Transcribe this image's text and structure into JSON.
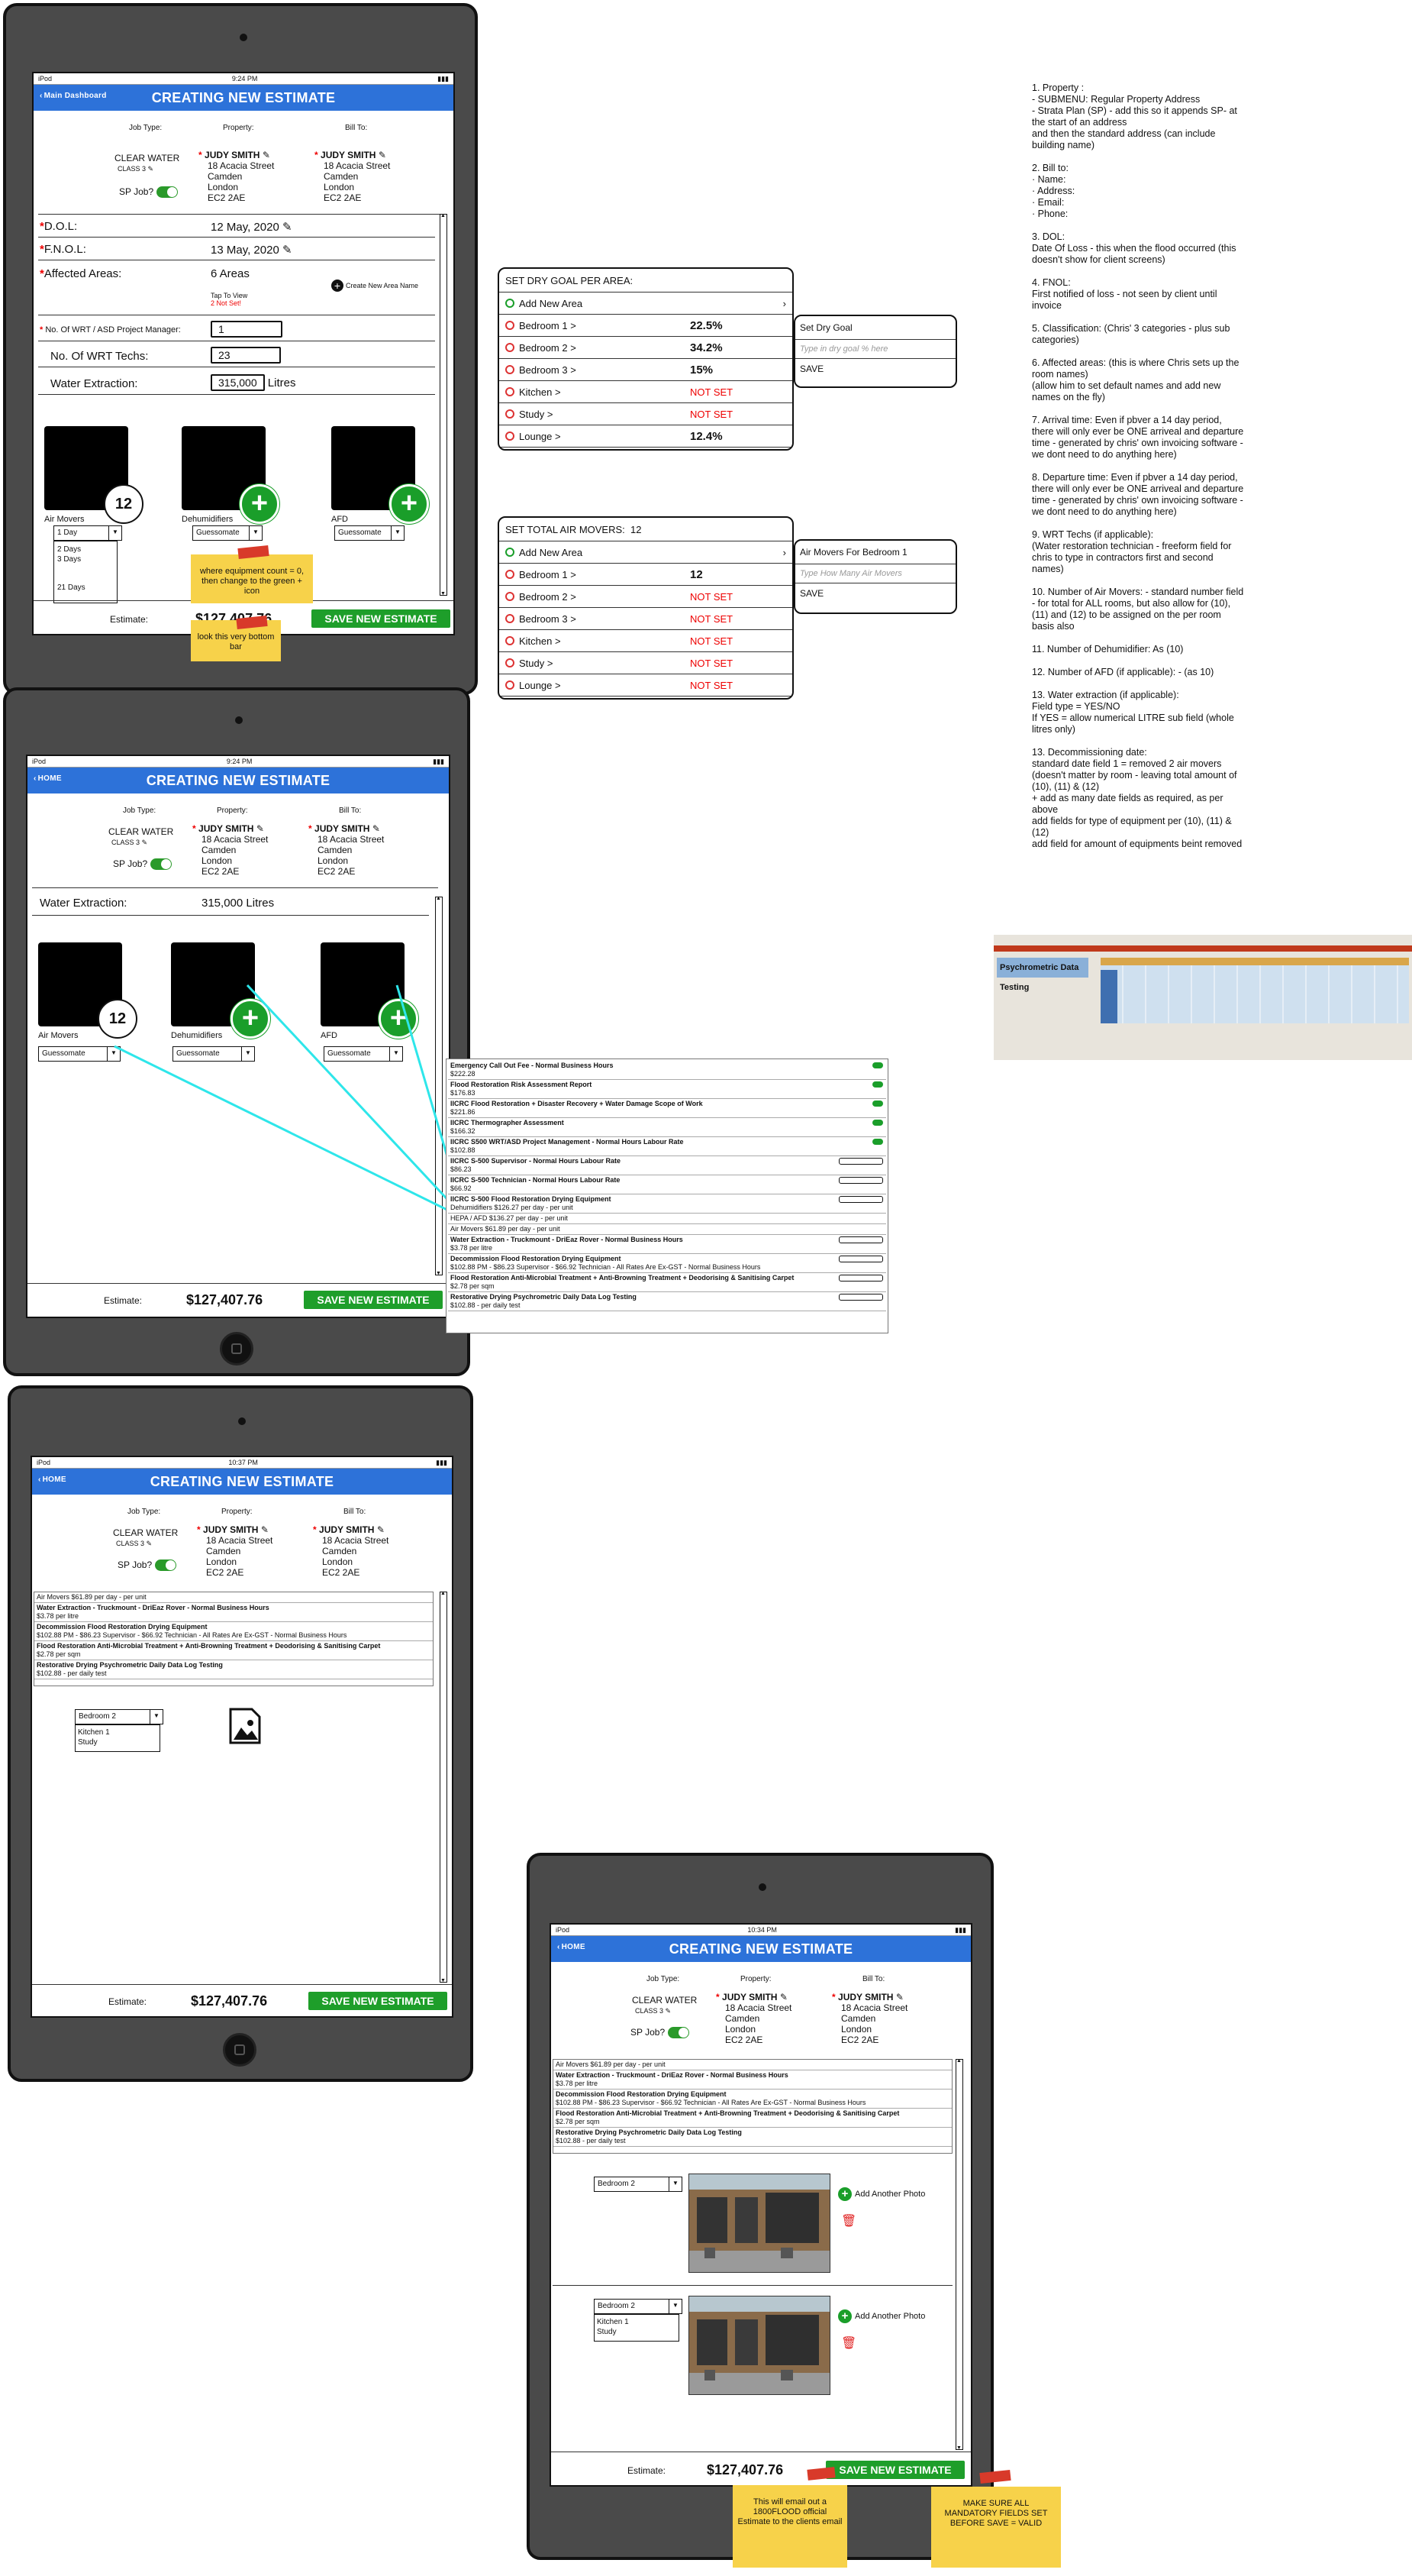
{
  "app": {
    "title": "CREATING NEW ESTIMATE",
    "back_dashboard": "Main Dashboard",
    "back_home": "HOME",
    "carrier": "iPod",
    "time1": "9:24 PM",
    "time2": "9:24 PM",
    "time3": "10:37 PM",
    "time4": "10:34 PM"
  },
  "header": {
    "job_type_col": "Job Type:",
    "property_col": "Property:",
    "bill_to_col": "Bill To:",
    "job_type": "CLEAR WATER",
    "job_class": "CLASS 3",
    "sp_job": "SP Job?",
    "property_name": "JUDY SMITH",
    "property_lines": [
      "18 Acacia Street",
      "Camden",
      "London",
      "EC2 2AE"
    ],
    "bill_name": "JUDY SMITH",
    "bill_lines": [
      "18 Acacia Street",
      "Camden",
      "London",
      "EC2 2AE"
    ]
  },
  "form": {
    "dol_label": "D.O.L:",
    "dol_value": "12 May, 2020",
    "fnol_label": "F.N.O.L:",
    "fnol_value": "13 May, 2020",
    "areas_label": "Affected Areas:",
    "areas_value": "6 Areas",
    "tap_to_view": "Tap To View",
    "not_set": "2 Not Set!",
    "create_area": "Create New Area Name",
    "pm_label": "No. Of WRT / ASD Project Manager:",
    "pm_value": "1",
    "techs_label": "No. Of WRT Techs:",
    "techs_value": "23",
    "water_label": "Water Extraction:",
    "water_value": "315,000",
    "water_unit": "Litres",
    "water_full": "315,000 Litres"
  },
  "equipment": {
    "air_movers": "Air Movers",
    "air_movers_count": "12",
    "dehumidifiers": "Dehumidifiers",
    "afd": "AFD",
    "dd_1day": "1 Day",
    "dd_options": [
      "2 Days",
      "3 Days",
      "21 Days"
    ],
    "guessomate": "Guessomate",
    "plus": "+"
  },
  "footer": {
    "estimate_label": "Estimate:",
    "estimate_value": "$127,407.76",
    "save_button": "SAVE NEW ESTIMATE"
  },
  "stickies": {
    "s1": "where equipment count = 0, then change to the green + icon",
    "s2": "look this very bottom bar",
    "s3": "This will email out a 1800FLOOD official Estimate to the clients email",
    "s4": "MAKE SURE ALL MANDATORY FIELDS SET BEFORE SAVE = VALID"
  },
  "dry_goal_panel": {
    "title": "SET DRY GOAL PER AREA:",
    "add": "Add New Area",
    "rows": [
      {
        "name": "Bedroom 1 >",
        "value": "22.5%"
      },
      {
        "name": "Bedroom 2 >",
        "value": "34.2%"
      },
      {
        "name": "Bedroom 3 >",
        "value": "15%"
      },
      {
        "name": "Kitchen >",
        "value": "NOT SET"
      },
      {
        "name": "Study >",
        "value": "NOT SET"
      },
      {
        "name": "Lounge >",
        "value": "12.4%"
      }
    ],
    "popup_title": "Set Dry Goal",
    "popup_placeholder": "Type in dry goal % here",
    "popup_save": "SAVE"
  },
  "air_movers_panel": {
    "title": "SET TOTAL AIR MOVERS:",
    "title_value": "12",
    "add": "Add New Area",
    "rows": [
      {
        "name": "Bedroom 1 >",
        "value": "12"
      },
      {
        "name": "Bedroom 2 >",
        "value": "NOT SET"
      },
      {
        "name": "Bedroom 3 >",
        "value": "NOT SET"
      },
      {
        "name": "Kitchen >",
        "value": "NOT SET"
      },
      {
        "name": "Study >",
        "value": "NOT SET"
      },
      {
        "name": "Lounge >",
        "value": "NOT SET"
      }
    ],
    "popup_title": "Air Movers For Bedroom 1",
    "popup_placeholder": "Type How Many Air Movers",
    "popup_save": "SAVE"
  },
  "fees": [
    {
      "title": "Emergency Call Out Fee - Normal Business Hours",
      "sub": "$222.28"
    },
    {
      "title": "Flood Restoration Risk Assessment Report",
      "sub": "$176.83"
    },
    {
      "title": "IICRC Flood Restoration + Disaster Recovery + Water Damage Scope of Work",
      "sub": "$221.86"
    },
    {
      "title": "IICRC Thermographer Assessment",
      "sub": "$166.32"
    },
    {
      "title": "IICRC S500 WRT/ASD Project Management - Normal Hours Labour Rate",
      "sub": "$102.88"
    },
    {
      "title": "IICRC S-500 Supervisor - Normal Hours Labour Rate",
      "sub": "$86.23"
    },
    {
      "title": "IICRC S-500 Technician - Normal Hours Labour Rate",
      "sub": "$66.92"
    },
    {
      "title": "IICRC S-500 Flood Restoration Drying Equipment",
      "sub": "Dehumidifiers $126.27 per day - per unit"
    },
    {
      "title": "",
      "sub": "HEPA / AFD $136.27 per day - per unit"
    },
    {
      "title": "",
      "sub": "Air Movers $61.89 per day - per unit"
    },
    {
      "title": "Water Extraction - Truckmount - DriEaz Rover - Normal Business Hours",
      "sub": "$3.78 per litre"
    },
    {
      "title": "Decommission Flood Restoration Drying Equipment",
      "sub": "$102.88 PM - $86.23 Supervisor - $66.92 Technician - All Rates Are Ex-GST - Normal Business Hours"
    },
    {
      "title": "Flood Restoration Anti-Microbial Treatment + Anti-Browning Treatment + Deodorising & Sanitising Carpet",
      "sub": "$2.78 per sqm"
    },
    {
      "title": "Restorative Drying Psychrometric Daily Data Log Testing",
      "sub": "$102.88 - per daily test"
    }
  ],
  "fees_short": [
    {
      "title": "",
      "sub": "Air Movers $61.89 per day - per unit"
    },
    {
      "title": "Water Extraction - Truckmount - DriEaz Rover - Normal Business Hours",
      "sub": "$3.78 per litre"
    },
    {
      "title": "Decommission Flood Restoration Drying Equipment",
      "sub": "$102.88 PM - $86.23 Supervisor - $66.92 Technician - All Rates Are Ex-GST - Normal Business Hours"
    },
    {
      "title": "Flood Restoration Anti-Microbial Treatment + Anti-Browning Treatment + Deodorising & Sanitising Carpet",
      "sub": "$2.78 per sqm"
    },
    {
      "title": "Restorative Drying Psychrometric Daily Data Log Testing",
      "sub": "$102.88 - per daily test"
    }
  ],
  "photos": {
    "room": "Bedroom 2",
    "options": [
      "Kitchen 1",
      "Study"
    ],
    "options_b": [
      "Kitchen 1",
      "Study"
    ],
    "add_photo": "Add Another Photo"
  },
  "notes": "1. Property :\n - SUBMENU: Regular Property Address\n - Strata Plan (SP) - add this so it appends SP- at the start of an address\n  and then the standard address (can include building name)\n\n2. Bill to:\n   ·   Name:\n   ·   Address:\n   ·   Email:\n   ·   Phone:\n\n3. DOL:\nDate Of Loss - this when the flood occurred (this doesn't show for client screens)\n\n4. FNOL:\nFirst notified of loss - not seen by client until invoice\n\n5. Classification: (Chris' 3 categories - plus sub categories)\n\n6. Affected areas: (this is where Chris sets up the room names)\n(allow him to set default names and add new names on the fly)\n\n7. Arrival time: Even if pbver a 14 day period, there will only ever be ONE arriveal and departure time - generated by chris' own invoicing software - we dont need to do anything here)\n\n8. Departure time: Even if pbver a 14 day period, there will only ever be ONE arriveal and departure time - generated by chris' own invoicing software - we dont need to do anything here)\n\n9. WRT Techs (if applicable):\n(Water restoration technician - freeform field for chris to type in contractors first and second names)\n\n10. Number of Air Movers: - standard number field - for total for ALL rooms, but also allow for (10), (11) and (12) to be assigned on the per room basis also\n\n11. Number of Dehumidifier: As (10)\n\n12. Number of AFD (if applicable): - (as 10)\n\n13. Water extraction (if applicable):\nField type = YES/NO\nIf YES = allow numerical LITRE sub field (whole litres only)\n\n13. Decommissioning date:\nstandard date field 1 = removed 2 air movers (doesn't matter by room - leaving total amount of (10), (11) & (12)\n+ add as many date fields as required, as per above\nadd fields for type of equipment per (10), (11) & (12)\nadd field for amount of equipments beint removed",
  "spreadsheet": {
    "title": "Psychrometric Data Testing"
  }
}
